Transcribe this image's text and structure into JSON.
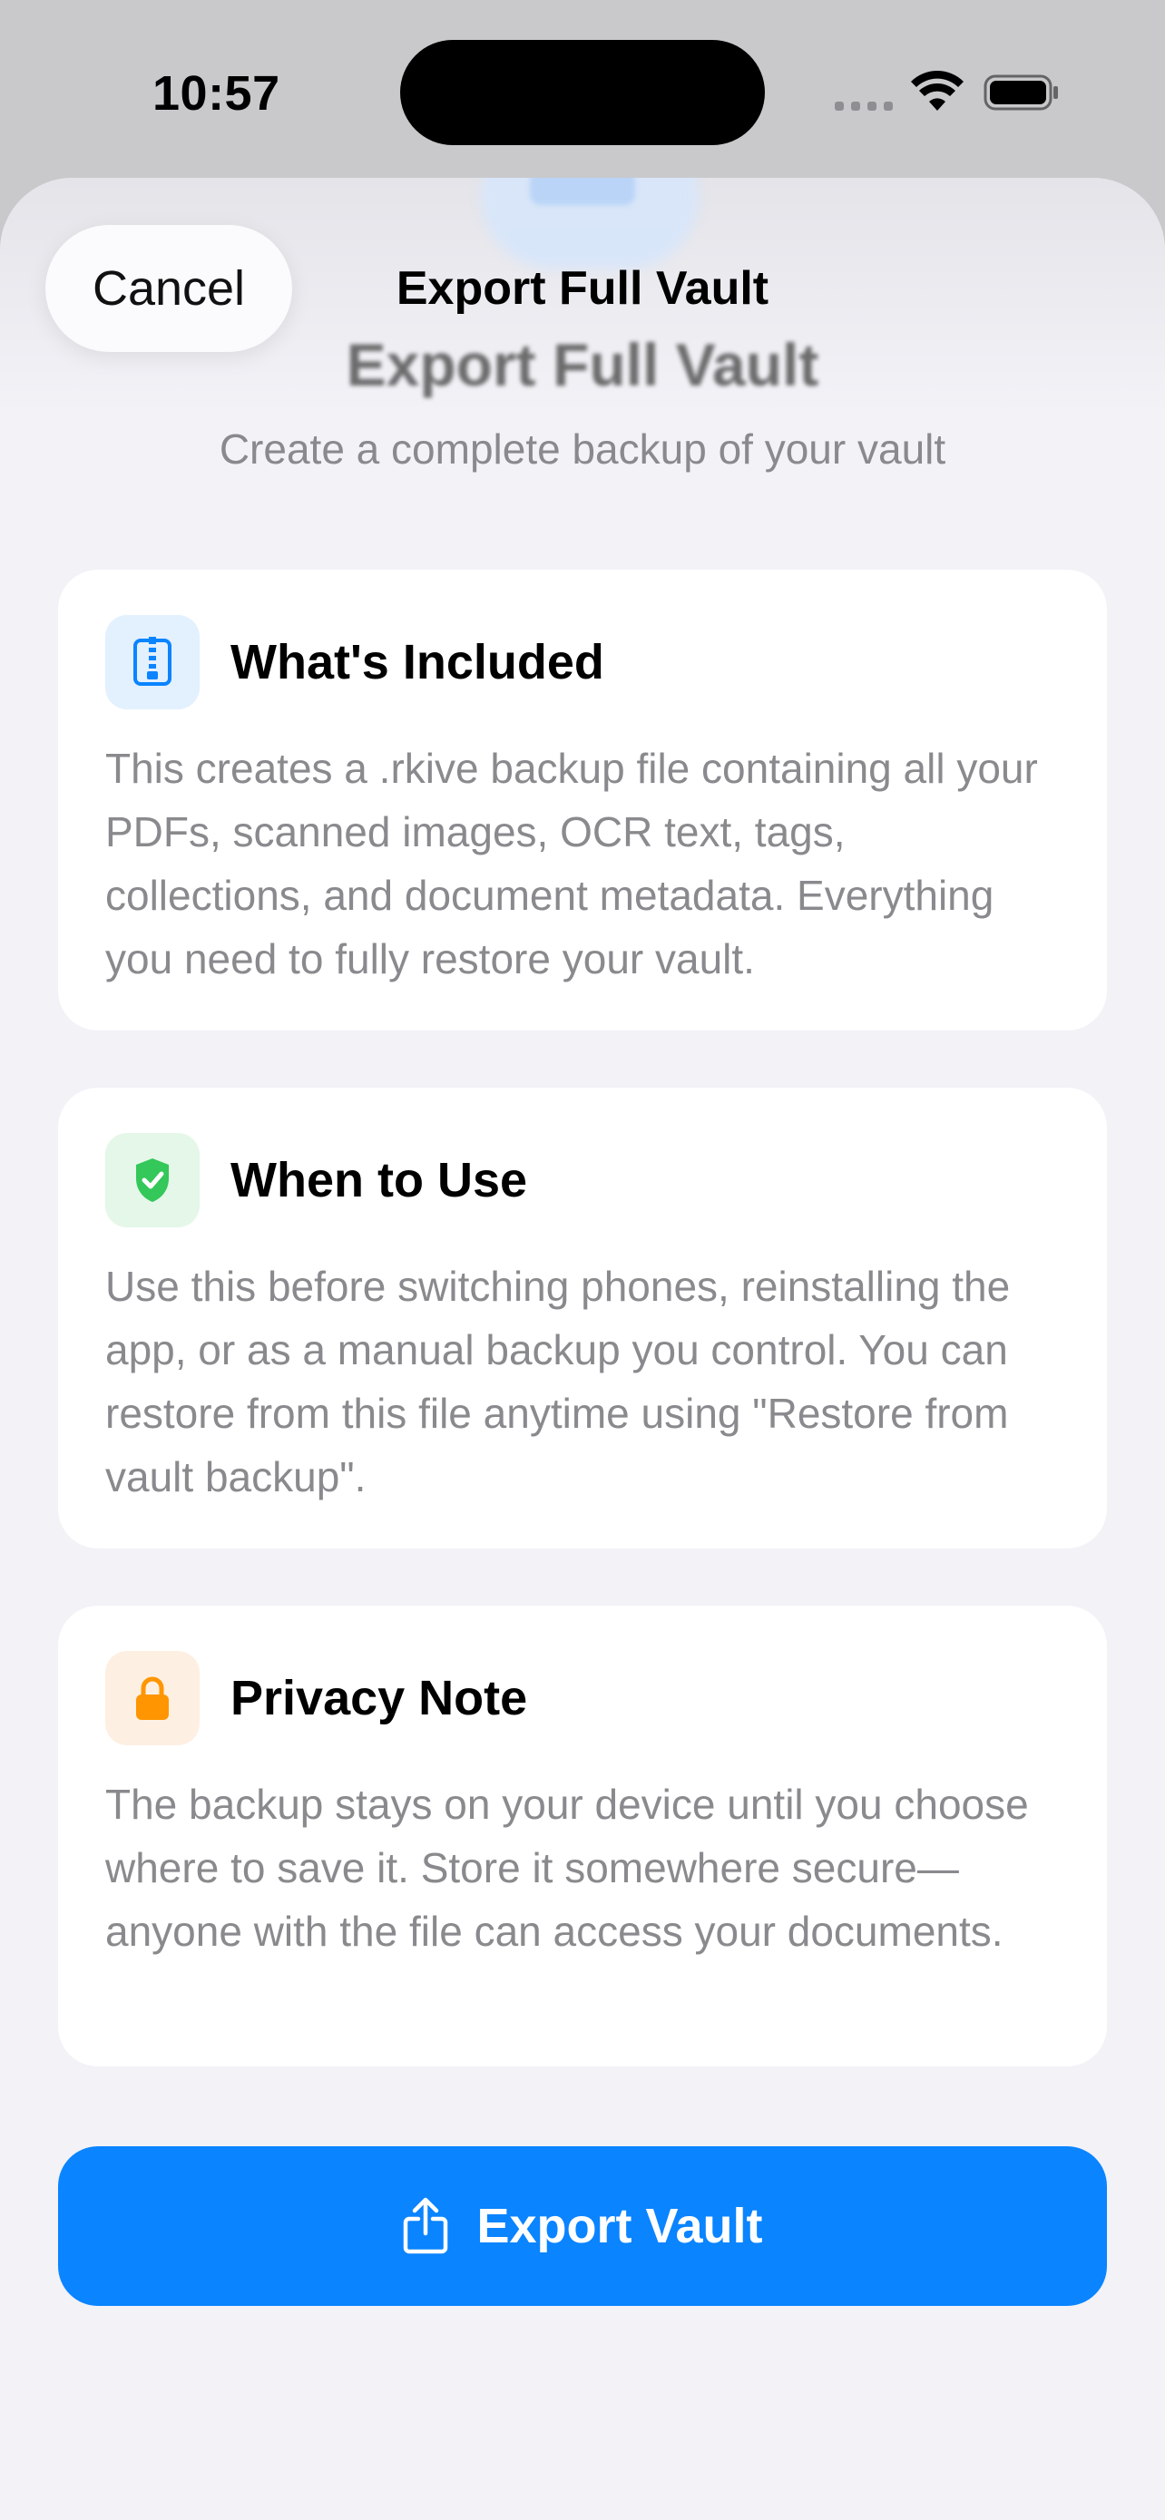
{
  "status_bar": {
    "time": "10:57"
  },
  "nav": {
    "cancel_label": "Cancel",
    "title": "Export Full Vault"
  },
  "header": {
    "title": "Export Full Vault",
    "subtitle": "Create a complete backup of your vault"
  },
  "cards": [
    {
      "title": "What's Included",
      "icon": "zip-file-icon",
      "body": "This creates a .rkive backup file containing all your PDFs, scanned images, OCR text, tags, collections, and document metadata. Everything you need to fully restore your vault."
    },
    {
      "title": "When to Use",
      "icon": "shield-check-icon",
      "body": "Use this before switching phones, reinstalling the app, or as a manual backup you control. You can restore from this file anytime using \"Restore from vault backup\"."
    },
    {
      "title": "Privacy Note",
      "icon": "lock-icon",
      "body": "The backup stays on your device until you choose where to save it. Store it somewhere secure—anyone with the file can access your documents."
    }
  ],
  "export_button": {
    "label": "Export Vault",
    "icon": "share-icon"
  },
  "colors": {
    "accent": "#0A84FF",
    "blue_icon": "#0A84FF",
    "green_icon": "#34C759",
    "orange_icon": "#FF9500",
    "sheet_background": "#F2F2F7"
  }
}
